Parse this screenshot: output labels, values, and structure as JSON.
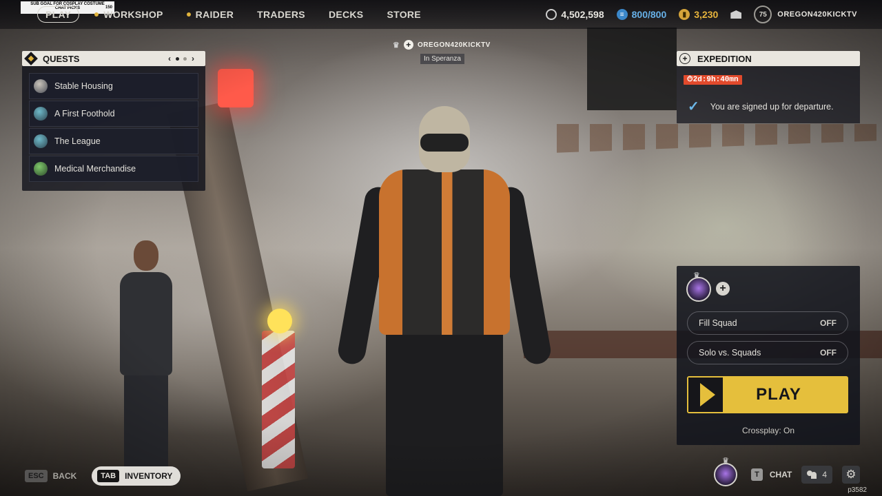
{
  "stream_overlay": {
    "line1": "SUB GOAL FOR COSPLAY COSTUME",
    "line2": "CHAT PICKS",
    "count": "150"
  },
  "nav": {
    "items": [
      {
        "label": "PLAY",
        "active": true
      },
      {
        "label": "WORKSHOP",
        "dot": true
      },
      {
        "label": "RAIDER",
        "dot": true
      },
      {
        "label": "TRADERS"
      },
      {
        "label": "DECKS"
      },
      {
        "label": "STORE"
      }
    ]
  },
  "currencies": {
    "coins": "4,502,598",
    "credits": "800/800",
    "tokens": "3,230"
  },
  "profile": {
    "level": "75",
    "username": "OREGON420KICKTV"
  },
  "quests": {
    "title": "QUESTS",
    "items": [
      {
        "label": "Stable Housing"
      },
      {
        "label": "A First Foothold"
      },
      {
        "label": "The League"
      },
      {
        "label": "Medical Merchandise"
      }
    ]
  },
  "nameplate": {
    "name": "OREGON420KICKTV",
    "location": "In Speranza"
  },
  "expedition": {
    "title": "EXPEDITION",
    "timer": "2d:9h:40mn",
    "status": "You are signed up for departure."
  },
  "play_panel": {
    "fill_squad_label": "Fill Squad",
    "fill_squad_state": "OFF",
    "solo_label": "Solo vs. Squads",
    "solo_state": "OFF",
    "play_label": "PLAY",
    "crossplay": "Crossplay: On"
  },
  "bottom": {
    "esc_key": "ESC",
    "back_label": "BACK",
    "tab_key": "TAB",
    "inventory_label": "INVENTORY",
    "chat_key": "T",
    "chat_label": "CHAT",
    "friends_count": "4",
    "build_id": "p3582"
  },
  "colors": {
    "accent_yellow": "#e5bf3c",
    "timer_red": "#e24a2c",
    "credits_blue": "#67b1e8",
    "check_blue": "#6cb7e8"
  },
  "icons": [
    "coin-icon",
    "credit-icon",
    "token-icon",
    "mail-icon",
    "crown-icon",
    "plus-icon",
    "check-icon",
    "people-icon",
    "gear-icon",
    "chevron-left-icon",
    "chevron-right-icon"
  ]
}
